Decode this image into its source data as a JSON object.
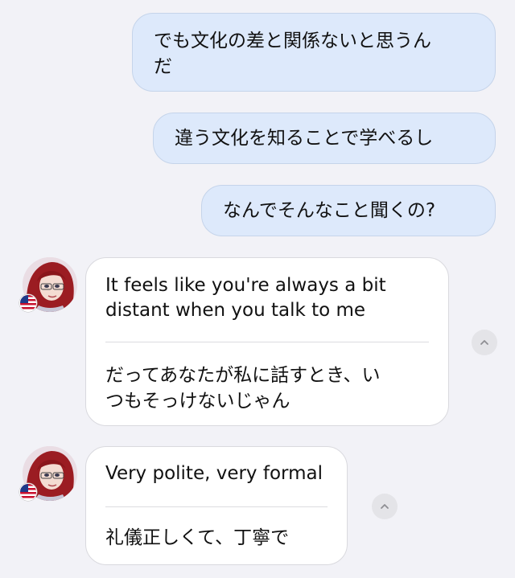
{
  "messages_out": [
    {
      "line1": "でも文化の差と関係ないと思うん",
      "line2": "だ"
    },
    {
      "text": "違う文化を知ることで学べるし"
    },
    {
      "text": "なんでそんなこと聞くの?"
    }
  ],
  "messages_in": [
    {
      "translation_line1": "It feels like you're always a bit",
      "translation_line2": "distant when you talk to me",
      "original_line1": "だってあなたが私に話すとき、い",
      "original_line2": "つもそっけないじゃん"
    },
    {
      "translation": "Very polite, very formal",
      "original": "礼儀正しくて、丁寧で"
    }
  ],
  "icons": {
    "avatar": "character-avatar",
    "flag": "us-flag-icon",
    "collapse": "chevron-up-icon"
  },
  "colors": {
    "background": "#f2f2f7",
    "outgoing_bubble": "#dde9fb",
    "incoming_bubble": "#ffffff"
  }
}
